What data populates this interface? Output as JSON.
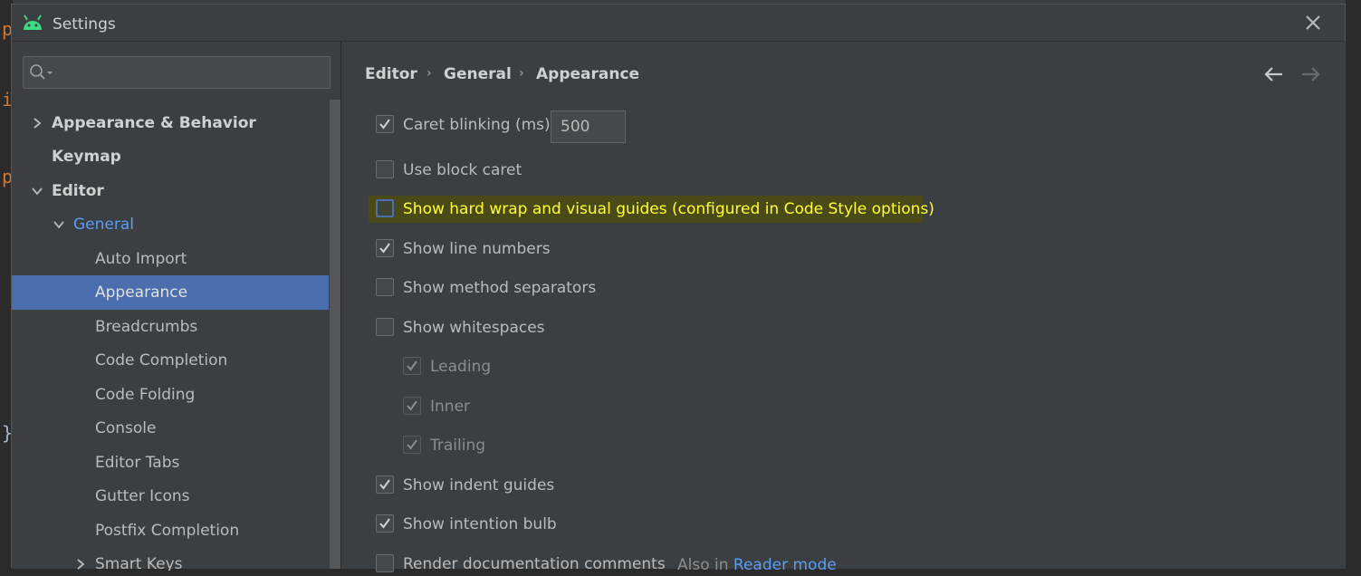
{
  "background_editor": {
    "glyphs": [
      "p",
      "i",
      "p",
      "}"
    ]
  },
  "dialog": {
    "title": "Settings",
    "app_icon": "android-icon",
    "close_icon": "close-icon"
  },
  "sidebar": {
    "search": {
      "placeholder": "",
      "value": "",
      "icon": "search-icon"
    },
    "tree": [
      {
        "label": "Appearance & Behavior",
        "expanded": false,
        "has_arrow": true
      },
      {
        "label": "Keymap",
        "expanded": false,
        "has_arrow": false
      },
      {
        "label": "Editor",
        "expanded": true,
        "has_arrow": true
      },
      {
        "label": "General",
        "expanded": true,
        "has_arrow": true
      },
      {
        "label": "Auto Import"
      },
      {
        "label": "Appearance",
        "selected": true
      },
      {
        "label": "Breadcrumbs"
      },
      {
        "label": "Code Completion"
      },
      {
        "label": "Code Folding"
      },
      {
        "label": "Console"
      },
      {
        "label": "Editor Tabs"
      },
      {
        "label": "Gutter Icons"
      },
      {
        "label": "Postfix Completion"
      },
      {
        "label": "Smart Keys",
        "has_arrow": true
      }
    ]
  },
  "content": {
    "breadcrumb": [
      "Editor",
      "General",
      "Appearance"
    ],
    "breadcrumb_sep": "›",
    "nav": {
      "back_icon": "arrow-left-icon",
      "forward_icon": "arrow-right-icon"
    },
    "options": [
      {
        "label": "Caret blinking (ms):",
        "checked": true,
        "value": "500"
      },
      {
        "label": "Use block caret",
        "checked": false
      },
      {
        "label": "Show hard wrap and visual guides (configured in Code Style options)",
        "checked": false,
        "highlighted": true
      },
      {
        "label": "Show line numbers",
        "checked": true
      },
      {
        "label": "Show method separators",
        "checked": false
      },
      {
        "label": "Show whitespaces",
        "checked": false
      },
      {
        "label": "Leading",
        "checked": true,
        "disabled": true
      },
      {
        "label": "Inner",
        "checked": true,
        "disabled": true
      },
      {
        "label": "Trailing",
        "checked": true,
        "disabled": true
      },
      {
        "label": "Show indent guides",
        "checked": true
      },
      {
        "label": "Show intention bulb",
        "checked": true
      },
      {
        "label": "Render documentation comments",
        "checked": false
      }
    ],
    "render_also": {
      "prefix": "Also in",
      "link": "Reader mode"
    }
  },
  "colors": {
    "dialog_bg": "#3c3f41",
    "selection": "#4b6eaf",
    "link": "#589df6",
    "highlight_bg": "#4a4a18",
    "highlight_text": "#ffff33"
  }
}
